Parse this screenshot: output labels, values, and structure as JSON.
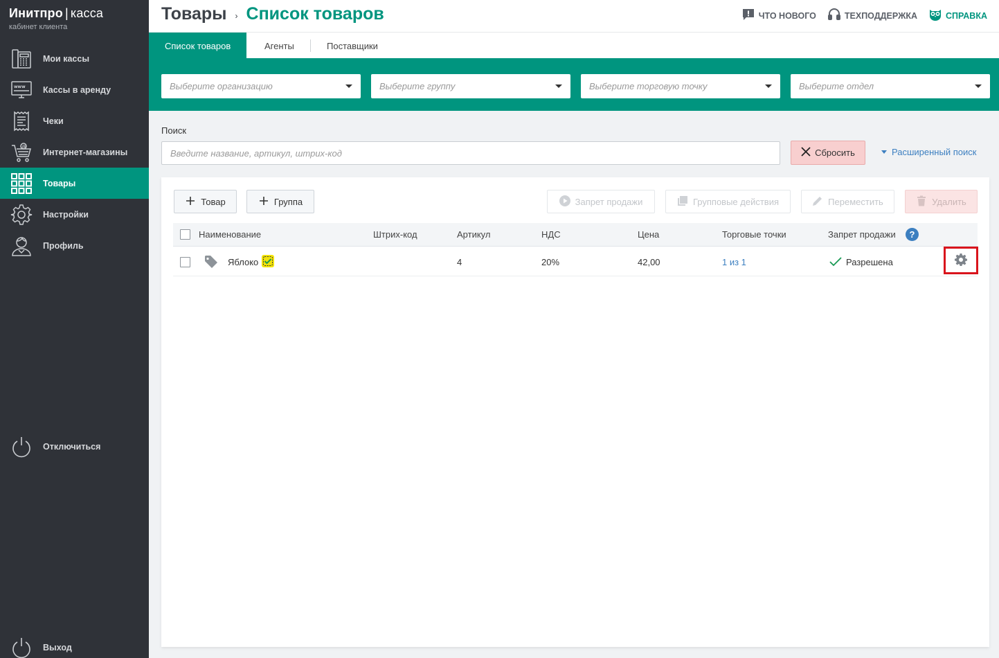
{
  "app": {
    "brand_main": "Инитпро",
    "brand_separator": "|",
    "brand_kassa": "касса",
    "brand_sub": "кабинет клиента"
  },
  "sidebar": {
    "items": [
      {
        "label": "Мои кассы",
        "icon": "cash-register-icon"
      },
      {
        "label": "Кассы в аренду",
        "icon": "www-monitor-icon"
      },
      {
        "label": "Чеки",
        "icon": "receipt-icon"
      },
      {
        "label": "Интернет-магазины",
        "icon": "cart-icon"
      },
      {
        "label": "Товары",
        "icon": "grid-icon",
        "active": true
      },
      {
        "label": "Настройки",
        "icon": "gear-icon"
      },
      {
        "label": "Профиль",
        "icon": "user-icon"
      }
    ],
    "disconnect_label": "Отключиться",
    "logout_label": "Выход"
  },
  "header": {
    "breadcrumb_root": "Товары",
    "breadcrumb_sep": "›",
    "breadcrumb_current": "Список товаров",
    "whats_new": "ЧТО НОВОГО",
    "support": "ТЕХПОДДЕРЖКА",
    "help": "СПРАВКА"
  },
  "tabs": [
    "Список товаров",
    "Агенты",
    "Поставщики"
  ],
  "filters": {
    "organization_placeholder": "Выберите организацию",
    "group_placeholder": "Выберите группу",
    "point_placeholder": "Выберите торговую точку",
    "department_placeholder": "Выберите отдел"
  },
  "search": {
    "label": "Поиск",
    "placeholder": "Введите название, артикул, штрих-код",
    "value": "",
    "reset_label": "Сбросить",
    "advanced_label": "Расширенный поиск"
  },
  "toolbar": {
    "add_product": "Товар",
    "add_group": "Группа",
    "ban_sale": "Запрет продажи",
    "group_actions": "Групповые действия",
    "move": "Переместить",
    "delete": "Удалить"
  },
  "table": {
    "columns": [
      "Наименование",
      "Штрих-код",
      "Артикул",
      "НДС",
      "Цена",
      "Торговые точки",
      "Запрет продажи"
    ],
    "help_glyph": "?",
    "rows": [
      {
        "name": "Яблоко",
        "barcode": "",
        "article": "4",
        "vat": "20%",
        "price": "42,00",
        "points": "1 из 1",
        "sale_status": "Разрешена"
      }
    ]
  },
  "colors": {
    "accent": "#00957f",
    "sidebar_bg": "#2f3238",
    "link": "#3c7fc0",
    "highlight_frame": "#d9141c"
  }
}
